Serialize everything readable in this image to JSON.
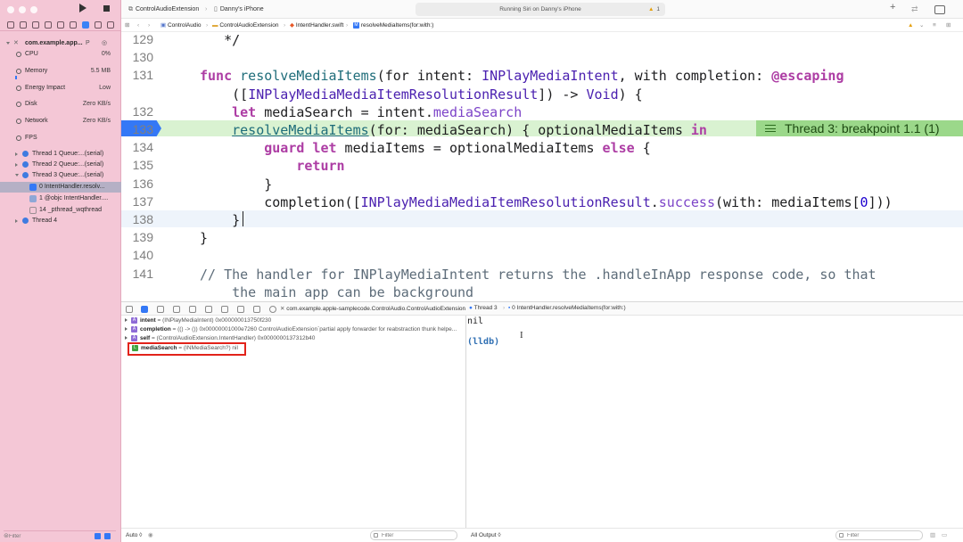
{
  "run_status": "Running Siri on Danny's iPhone",
  "warnings": {
    "icon": "warning-triangle-icon",
    "count": "1"
  },
  "scheme": {
    "target": "ControlAudioExtension",
    "device": "Danny's iPhone"
  },
  "jumpbar": {
    "items": [
      "ControlAudio",
      "ControlAudioExtension",
      "IntentHandler.swift",
      "resolveMediaItems(for:with:)"
    ]
  },
  "debug_navigator": {
    "process": "com.example.app...",
    "process_badge": "P",
    "gauges": [
      {
        "label": "CPU",
        "value": "0%"
      },
      {
        "label": "Memory",
        "value": "5.5 MB"
      },
      {
        "label": "Energy Impact",
        "value": "Low"
      },
      {
        "label": "Disk",
        "value": "Zero KB/s"
      },
      {
        "label": "Network",
        "value": "Zero KB/s"
      },
      {
        "label": "FPS",
        "value": ""
      }
    ],
    "threads": [
      {
        "label": "Thread 1 Queue:...(serial)"
      },
      {
        "label": "Thread 2 Queue:...(serial)"
      },
      {
        "label": "Thread 3 Queue:...(serial)"
      },
      {
        "label": "Thread 4"
      }
    ],
    "frames": [
      {
        "label": "0 IntentHandler.resolv..."
      },
      {
        "label": "1 @objc IntentHandler...."
      },
      {
        "label": "14 _pthread_wqthread"
      }
    ],
    "filter_placeholder": "Filter"
  },
  "editor": {
    "lines": [
      {
        "n": "129",
        "html": "   */"
      },
      {
        "n": "130",
        "html": ""
      },
      {
        "n": "131",
        "html": "<span class=\"k\">func</span> <span class=\"fn\">resolveMediaItems</span>(for intent: <span class=\"t2\">INPlayMediaIntent</span>, with completion: <span class=\"k\">@escaping</span>"
      },
      {
        "n": "",
        "html": "    ([<span class=\"t2\">INPlayMediaMediaItemResolutionResult</span>]) -&gt; <span class=\"t2\">Void</span>) {"
      },
      {
        "n": "132",
        "html": "    <span class=\"k\">let</span> mediaSearch = intent.<span class=\"pr\">mediaSearch</span>"
      },
      {
        "n": "133",
        "html": "    <span class=\"fn\" style=\"text-decoration:underline\">resolveMediaItems</span>(for: mediaSearch) { optionalMediaItems <span class=\"k\">in</span>"
      },
      {
        "n": "134",
        "html": "        <span class=\"k\">guard</span> <span class=\"k\">let</span> mediaItems = optionalMediaItems <span class=\"k\">else</span> {"
      },
      {
        "n": "135",
        "html": "            <span class=\"k\">return</span>"
      },
      {
        "n": "136",
        "html": "        }"
      },
      {
        "n": "137",
        "html": "        completion([<span class=\"t2\">INPlayMediaMediaItemResolutionResult</span>.<span class=\"pr\">success</span>(with: mediaItems[<span class=\"num\">0</span>]))"
      },
      {
        "n": "138",
        "html": "    }"
      },
      {
        "n": "139",
        "html": "}"
      },
      {
        "n": "140",
        "html": ""
      },
      {
        "n": "141",
        "html": "<span class=\"cm\">// The handler for INPlayMediaIntent returns the .handleInApp response code, so that</span>"
      },
      {
        "n": "",
        "html": "<span class=\"cm\">    the main app can be background</span>"
      }
    ],
    "breakpoint_label": "Thread 3: breakpoint 1.1 (1)"
  },
  "debug_bar": {
    "path": "com.example.apple-samplecode.ControlAudio.ControlAudioExtension",
    "thread": "Thread 3",
    "frame": "0 IntentHandler.resolveMediaItems(for:with:)"
  },
  "variables": [
    {
      "name": "intent",
      "value": "= (INPlayMediaIntent) 0x000000013750f230",
      "badge": "A",
      "badge_color": "#8e6bd6"
    },
    {
      "name": "completion",
      "value": "= (() -> ()) 0x00000001000e7260 ControlAudioExtension`partial apply forwarder for reabstraction thunk helpe...",
      "badge": "A",
      "badge_color": "#8e6bd6"
    },
    {
      "name": "self",
      "value": "= (ControlAudioExtension.IntentHandler) 0x0000000137312b40",
      "badge": "A",
      "badge_color": "#8e6bd6"
    },
    {
      "name": "mediaSearch",
      "value": "= (INMediaSearch?) nil",
      "badge": "L",
      "badge_color": "#3fa33f"
    }
  ],
  "console": {
    "output": "nil",
    "prompt": "(lldb)"
  },
  "bottom": {
    "scope": "Auto ◊",
    "filter_left": "Filter",
    "output_mode": "All Output ◊",
    "filter_right": "Filter"
  }
}
